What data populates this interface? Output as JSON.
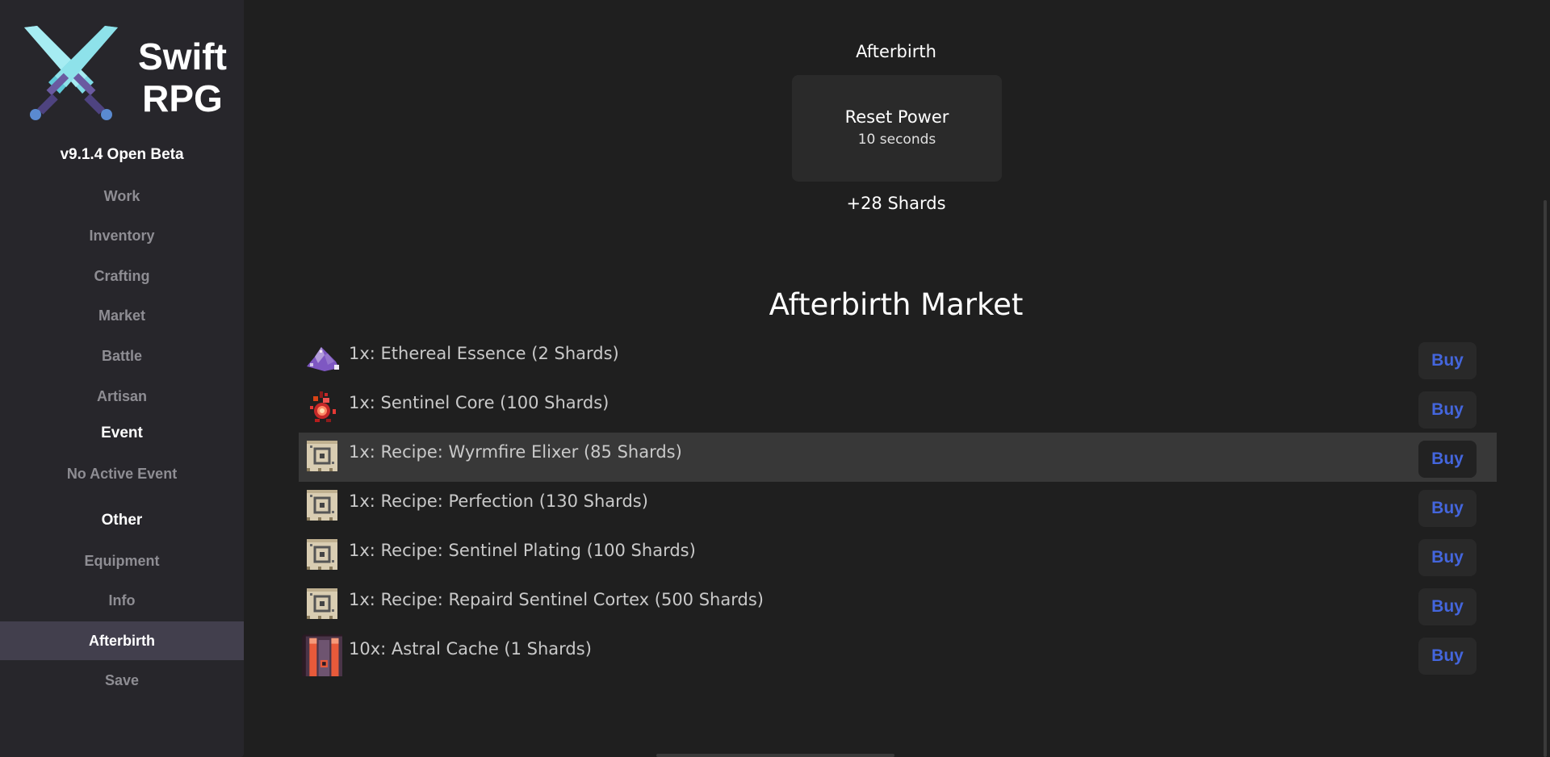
{
  "sidebar": {
    "brand_line1": "Swift",
    "brand_line2": "RPG",
    "logo_icon": "crossed-swords-icon",
    "version": "v9.1.4 Open Beta",
    "items": {
      "work": "Work",
      "inventory": "Inventory",
      "crafting": "Crafting",
      "market": "Market",
      "battle": "Battle",
      "artisan": "Artisan",
      "event_heading": "Event",
      "no_active_event": "No Active Event",
      "other_heading": "Other",
      "equipment": "Equipment",
      "info": "Info",
      "afterbirth": "Afterbirth",
      "save": "Save"
    },
    "active_item": "afterbirth"
  },
  "main": {
    "title": "Afterbirth",
    "reset_label": "Reset Power",
    "reset_time": "10 seconds",
    "gain": "+28 Shards",
    "market_title": "Afterbirth Market",
    "buy_label": "Buy",
    "items": [
      {
        "text": "1x: Ethereal Essence (2 Shards)",
        "icon": "ethereal-essence-icon"
      },
      {
        "text": "1x: Sentinel Core (100 Shards)",
        "icon": "sentinel-core-icon"
      },
      {
        "text": "1x: Recipe: Wyrmfire Elixer (85 Shards)",
        "icon": "recipe-scroll-icon"
      },
      {
        "text": "1x: Recipe: Perfection (130 Shards)",
        "icon": "recipe-scroll-icon"
      },
      {
        "text": "1x: Recipe: Sentinel Plating (100 Shards)",
        "icon": "recipe-scroll-icon"
      },
      {
        "text": "1x: Recipe: Repaird Sentinel Cortex (500 Shards)",
        "icon": "recipe-scroll-icon"
      },
      {
        "text": "10x: Astral Cache (1 Shards)",
        "icon": "astral-cache-chest-icon"
      }
    ]
  },
  "colors": {
    "sidebar_bg": "#27262b",
    "main_bg": "#1f1f1f",
    "active_nav_bg": "#423f4d",
    "buy_text": "#4466dd",
    "logo_blade": "#6fd3e0",
    "logo_hilt": "#5a4a8a"
  }
}
